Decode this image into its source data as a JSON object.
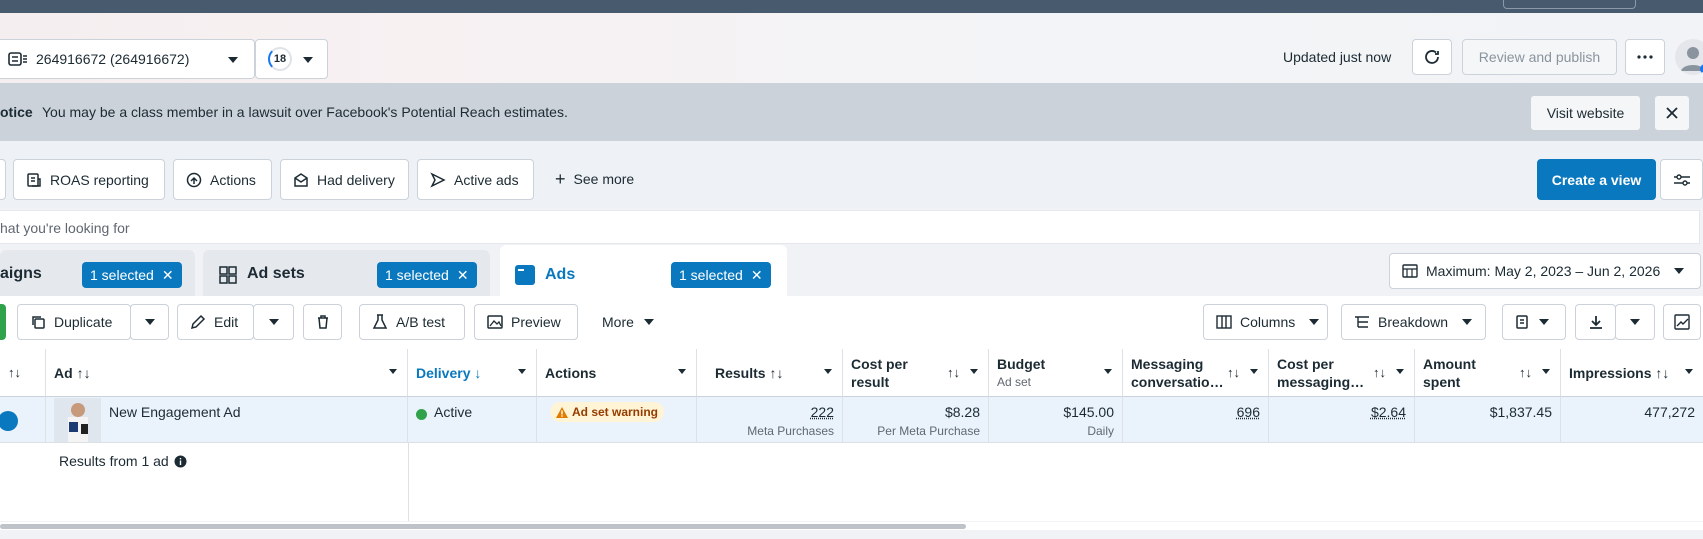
{
  "header": {
    "account_name": "264916672 (264916672)",
    "progress_count": "18",
    "updated_text": "Updated just now",
    "review_label": "Review and publish"
  },
  "notice": {
    "label": "otice",
    "message": "You may be a class member in a lawsuit over Facebook's Potential Reach estimates.",
    "visit_label": "Visit website"
  },
  "views": {
    "items": [
      "ROAS reporting",
      "Actions",
      "Had delivery",
      "Active ads",
      "See more"
    ],
    "create_label": "Create a view"
  },
  "search": {
    "placeholder": "hat you're looking for"
  },
  "tabs": {
    "campaigns": {
      "label": "aigns",
      "selected": "1 selected"
    },
    "adsets": {
      "label": "Ad sets",
      "selected": "1 selected"
    },
    "ads": {
      "label": "Ads",
      "selected": "1 selected"
    }
  },
  "date_range": "Maximum: May 2, 2023 – Jun 2, 2026",
  "toolbar": {
    "duplicate": "Duplicate",
    "edit": "Edit",
    "ab_test": "A/B test",
    "preview": "Preview",
    "more": "More",
    "columns": "Columns",
    "breakdown": "Breakdown"
  },
  "table": {
    "columns": {
      "ad": "Ad",
      "delivery": "Delivery",
      "actions": "Actions",
      "results": "Results",
      "cost_per_result": "Cost per result",
      "budget": "Budget",
      "budget_sub": "Ad set",
      "messaging": "Messaging conversatio…",
      "cost_messaging": "Cost per messaging…",
      "amount_spent": "Amount spent",
      "impressions": "Impressions"
    },
    "row": {
      "ad_name": "New Engagement Ad",
      "delivery": "Active",
      "actions": "Ad set warning",
      "results": "222",
      "results_unit": "Meta Purchases",
      "cost_per_result": "$8.28",
      "cost_per_result_unit": "Per Meta Purchase",
      "budget": "$145.00",
      "budget_unit": "Daily",
      "messaging": "696",
      "cost_messaging": "$2.64",
      "amount_spent": "$1,837.45",
      "impressions": "477,272"
    },
    "footer": "Results from 1 ad"
  },
  "colors": {
    "accent": "#0a78be",
    "active": "#31a24c",
    "warning": "#f7b928"
  }
}
